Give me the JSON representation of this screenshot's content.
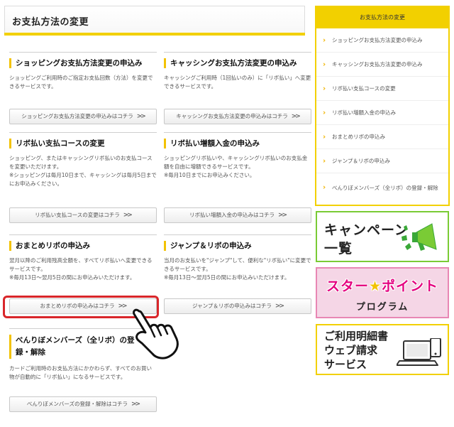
{
  "page": {
    "title": "お支払方法の変更"
  },
  "sections": [
    {
      "heading": "ショッピングお支払方法変更の申込み",
      "desc": "ショッピングご利用時のご指定お支払回数（方法）を変更できるサービスです。",
      "note": "",
      "button": "ショッピングお支払方法変更の申込みはコチラ"
    },
    {
      "heading": "キャッシングお支払方法変更の申込み",
      "desc": "キャッシングご利用時（1回払いのみ）に「リボ払い」へ変更できるサービスです。",
      "note": "",
      "button": "キャッシングお支払方法変更の申込みはコチラ"
    },
    {
      "heading": "リボ払い支払コースの変更",
      "desc": "ショッピング、またはキャッシングリボ払いのお支払コースを変更いただけます。",
      "note": "※ショッピングは毎月10日まで、キャッシングは毎月5日までにお申込みください。",
      "button": "リボ払い支払コースの変更はコチラ"
    },
    {
      "heading": "リボ払い増額入金の申込み",
      "desc": "ショッピングリボ払いや、キャッシングリボ払いのお支払金額を自由に増額できるサービスです。",
      "note": "※毎月10日までにお申込みください。",
      "button": "リボ払い増額入金の申込みはコチラ"
    },
    {
      "heading": "おまとめリボの申込み",
      "desc": "翌月以降のご利用残高全額を、すべてリボ払いへ変更できるサービスです。",
      "note": "※毎月13日～翌月5日の間にお申込みいただけます。",
      "button": "おまとめリボの申込みはコチラ"
    },
    {
      "heading": "ジャンプ＆リボの申込み",
      "desc": "当月のお支払いを\"ジャンプ\"して、便利な\"リボ払い\"に変更できるサービスです。",
      "note": "※毎月13日～翌月5日の間にお申込みいただけます。",
      "button": "ジャンプ＆リボの申込みはコチラ"
    },
    {
      "heading": "べんりぼメンバーズ（全リボ）の登録・解除",
      "desc": "カードご利用時のお支払方法にかかわらず、すべてのお買い物が自動的に「リボ払い」になるサービスです。",
      "note": "",
      "button": "べんりぼメンバーズの登録・解除はコチラ"
    }
  ],
  "sidebar": {
    "title": "お支払方法の変更",
    "items": [
      "ショッピングお支払方法変更の申込み",
      "キャッシングお支払方法変更の申込み",
      "リボ払い支払コースの変更",
      "リボ払い増額入金の申込み",
      "おまとめリボの申込み",
      "ジャンプ＆リボの申込み",
      "べんりぼメンバーズ（全リボ）の登録・解除"
    ]
  },
  "banners": {
    "campaign": {
      "line1": "キャンペーン",
      "line2": "一覧"
    },
    "star_point": {
      "star_part": "スター",
      "point_part": "ポイント",
      "line2": "プログラム"
    },
    "statement": {
      "line1": "ご利用明細書",
      "line2": "ウェブ請求",
      "line3": "サービス"
    }
  },
  "colors": {
    "accent_yellow": "#f2d000",
    "highlight_red": "#d9262a",
    "campaign_green": "#7acb35",
    "star_pink": "#e4007f"
  },
  "icons": {
    "button_arrow": "double-chevron-right",
    "sidebar_bullet": "chevron-right",
    "pointer": "hand-pointer"
  }
}
